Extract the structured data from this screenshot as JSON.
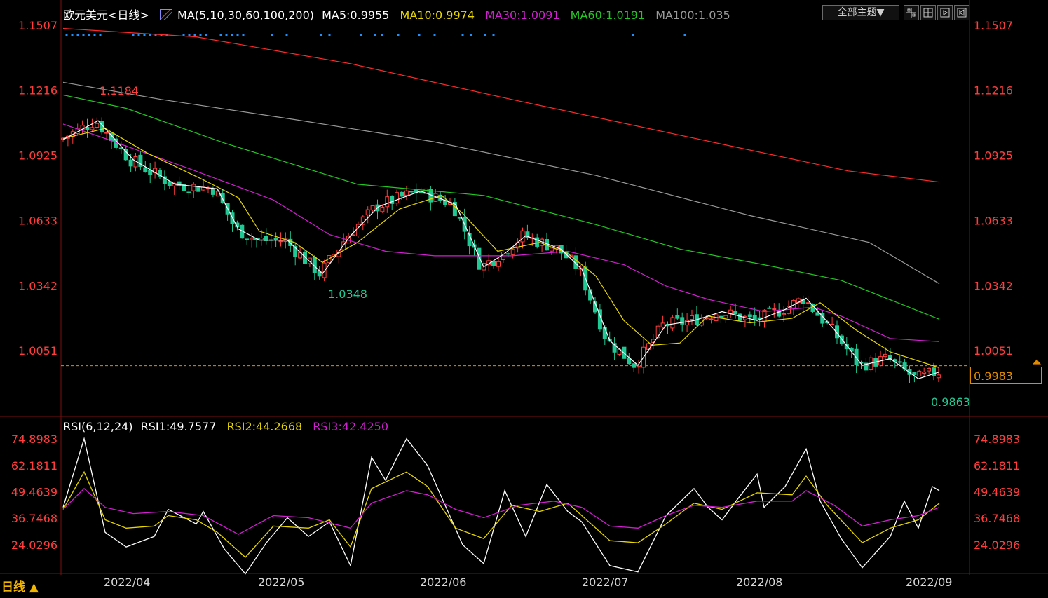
{
  "header": {
    "title": "欧元美元<日线>",
    "ma_label": "MA(5,10,30,60,100,200)",
    "ma_values": [
      {
        "text": "MA5:0.9955",
        "color": "#ffffff"
      },
      {
        "text": "MA10:0.9974",
        "color": "#e8d800"
      },
      {
        "text": "MA30:1.0091",
        "color": "#d21fd2"
      },
      {
        "text": "MA60:1.0191",
        "color": "#22c922"
      },
      {
        "text": "MA100:1.035",
        "color": "#9a9a9a"
      }
    ],
    "theme_button": "全部主题▼",
    "toolbar_icons": [
      "grid-icon",
      "split-icon",
      "export-icon",
      "fullscreen-icon"
    ]
  },
  "rsi_header": {
    "label": "RSI(6,12,24)",
    "values": [
      {
        "text": "RSI1:49.7577",
        "color": "#ffffff"
      },
      {
        "text": "RSI2:44.2668",
        "color": "#e8d800"
      },
      {
        "text": "RSI3:42.4250",
        "color": "#d21fd2"
      }
    ]
  },
  "period_label": "日线 ▲",
  "current_price": "0.9983",
  "colors": {
    "up": "#ff3d3d",
    "down": "#20c994",
    "axis_text": "#ff3d3d",
    "ma200": "#ff2a2a",
    "dashed": "#e08a00",
    "signal_dots": "#1e90ff"
  },
  "chart_data": {
    "type": "candlestick",
    "title": "欧元美元<日线>",
    "price_axis": {
      "ticks": [
        "1.1507",
        "1.1216",
        "1.0925",
        "1.0633",
        "1.0342",
        "1.0051"
      ],
      "range": [
        0.978,
        1.1507
      ]
    },
    "rsi_axis": {
      "ticks": [
        "74.8983",
        "62.1811",
        "49.4639",
        "36.7468",
        "24.0296"
      ]
    },
    "x_axis": {
      "labels": [
        "2022/04",
        "2022/05",
        "2022/06",
        "2022/07",
        "2022/08",
        "2022/09"
      ]
    },
    "annotations": {
      "high": "1.1184",
      "low_may": "1.0348",
      "low_sep": "0.9863"
    },
    "ma_series": [
      {
        "name": "MA200",
        "color": "#ff2a2a",
        "points": [
          [
            0,
            1.1493
          ],
          [
            190,
            1.1455
          ],
          [
            410,
            1.1335
          ],
          [
            640,
            1.1175
          ],
          [
            880,
            1.1015
          ],
          [
            1120,
            1.0855
          ],
          [
            1250,
            1.0805
          ]
        ]
      },
      {
        "name": "MA100",
        "color": "#9a9a9a",
        "points": [
          [
            0,
            1.1252
          ],
          [
            140,
            1.1175
          ],
          [
            330,
            1.1085
          ],
          [
            530,
            1.0985
          ],
          [
            760,
            1.0835
          ],
          [
            980,
            1.0655
          ],
          [
            1150,
            1.0535
          ],
          [
            1250,
            1.035
          ]
        ]
      },
      {
        "name": "MA60",
        "color": "#22c922",
        "points": [
          [
            0,
            1.1195
          ],
          [
            90,
            1.1135
          ],
          [
            230,
            1.098
          ],
          [
            420,
            1.0795
          ],
          [
            600,
            1.0745
          ],
          [
            760,
            1.0615
          ],
          [
            880,
            1.0505
          ],
          [
            1000,
            1.0435
          ],
          [
            1110,
            1.0365
          ],
          [
            1250,
            1.0191
          ]
        ]
      },
      {
        "name": "MA30",
        "color": "#d21fd2",
        "points": [
          [
            0,
            1.1065
          ],
          [
            60,
            1.1
          ],
          [
            180,
            1.0865
          ],
          [
            300,
            1.0725
          ],
          [
            380,
            1.057
          ],
          [
            460,
            1.0495
          ],
          [
            530,
            1.0475
          ],
          [
            640,
            1.0475
          ],
          [
            720,
            1.0495
          ],
          [
            800,
            1.0435
          ],
          [
            860,
            1.034
          ],
          [
            920,
            1.028
          ],
          [
            1000,
            1.0225
          ],
          [
            1070,
            1.0245
          ],
          [
            1110,
            1.0205
          ],
          [
            1180,
            1.0105
          ],
          [
            1250,
            1.0091
          ]
        ]
      },
      {
        "name": "MA10",
        "color": "#e8d800",
        "points": [
          [
            0,
            1.1
          ],
          [
            60,
            1.1045
          ],
          [
            120,
            1.0935
          ],
          [
            200,
            1.0815
          ],
          [
            250,
            1.0735
          ],
          [
            280,
            1.0585
          ],
          [
            330,
            1.0535
          ],
          [
            370,
            1.0445
          ],
          [
            420,
            1.0535
          ],
          [
            480,
            1.0685
          ],
          [
            540,
            1.0745
          ],
          [
            570,
            1.0665
          ],
          [
            620,
            1.0495
          ],
          [
            680,
            1.0535
          ],
          [
            720,
            1.0485
          ],
          [
            760,
            1.0385
          ],
          [
            800,
            1.0185
          ],
          [
            840,
            1.0075
          ],
          [
            880,
            1.0085
          ],
          [
            920,
            1.0205
          ],
          [
            980,
            1.0175
          ],
          [
            1040,
            1.0195
          ],
          [
            1080,
            1.0265
          ],
          [
            1130,
            1.0145
          ],
          [
            1180,
            1.0045
          ],
          [
            1250,
            0.9974
          ]
        ]
      },
      {
        "name": "MA5",
        "color": "#ffffff",
        "points": [
          [
            0,
            1.0995
          ],
          [
            50,
            1.108
          ],
          [
            100,
            1.0905
          ],
          [
            160,
            1.0795
          ],
          [
            220,
            1.0775
          ],
          [
            250,
            1.0595
          ],
          [
            280,
            1.0545
          ],
          [
            320,
            1.0545
          ],
          [
            370,
            1.0395
          ],
          [
            410,
            1.0565
          ],
          [
            450,
            1.0695
          ],
          [
            510,
            1.0765
          ],
          [
            560,
            1.0705
          ],
          [
            600,
            1.0425
          ],
          [
            630,
            1.0485
          ],
          [
            660,
            1.0565
          ],
          [
            710,
            1.0505
          ],
          [
            740,
            1.0415
          ],
          [
            780,
            1.0095
          ],
          [
            820,
            0.9985
          ],
          [
            860,
            1.0165
          ],
          [
            900,
            1.0185
          ],
          [
            940,
            1.0225
          ],
          [
            990,
            1.0185
          ],
          [
            1030,
            1.0235
          ],
          [
            1060,
            1.0285
          ],
          [
            1100,
            1.0145
          ],
          [
            1140,
            0.9985
          ],
          [
            1180,
            1.0015
          ],
          [
            1220,
            0.9925
          ],
          [
            1250,
            0.9955
          ]
        ]
      },
      {
        "name": "RSI1",
        "color": "#ffffff",
        "points": [
          [
            0,
            42
          ],
          [
            30,
            75
          ],
          [
            60,
            30
          ],
          [
            90,
            23
          ],
          [
            130,
            28
          ],
          [
            150,
            41
          ],
          [
            190,
            34
          ],
          [
            200,
            40
          ],
          [
            230,
            22
          ],
          [
            260,
            10
          ],
          [
            290,
            25
          ],
          [
            320,
            37
          ],
          [
            350,
            28
          ],
          [
            380,
            35
          ],
          [
            410,
            14
          ],
          [
            440,
            66
          ],
          [
            460,
            55
          ],
          [
            490,
            75
          ],
          [
            520,
            62
          ],
          [
            570,
            24
          ],
          [
            600,
            15
          ],
          [
            630,
            50
          ],
          [
            660,
            28
          ],
          [
            690,
            53
          ],
          [
            720,
            40
          ],
          [
            740,
            35
          ],
          [
            780,
            14
          ],
          [
            820,
            11
          ],
          [
            860,
            38
          ],
          [
            900,
            51
          ],
          [
            920,
            42
          ],
          [
            940,
            36
          ],
          [
            960,
            45
          ],
          [
            990,
            58
          ],
          [
            1000,
            42
          ],
          [
            1030,
            52
          ],
          [
            1060,
            70
          ],
          [
            1080,
            45
          ],
          [
            1110,
            27
          ],
          [
            1140,
            13
          ],
          [
            1180,
            28
          ],
          [
            1200,
            45
          ],
          [
            1220,
            32
          ],
          [
            1240,
            52
          ],
          [
            1250,
            50
          ]
        ]
      },
      {
        "name": "RSI2",
        "color": "#e8d800",
        "points": [
          [
            0,
            41
          ],
          [
            30,
            59
          ],
          [
            60,
            36
          ],
          [
            90,
            32
          ],
          [
            130,
            33
          ],
          [
            150,
            38
          ],
          [
            190,
            36
          ],
          [
            220,
            30
          ],
          [
            260,
            18
          ],
          [
            300,
            33
          ],
          [
            350,
            32
          ],
          [
            380,
            36
          ],
          [
            410,
            23
          ],
          [
            440,
            51
          ],
          [
            490,
            59
          ],
          [
            520,
            52
          ],
          [
            560,
            32
          ],
          [
            600,
            27
          ],
          [
            640,
            43
          ],
          [
            680,
            40
          ],
          [
            720,
            44
          ],
          [
            780,
            26
          ],
          [
            820,
            25
          ],
          [
            860,
            34
          ],
          [
            900,
            44
          ],
          [
            940,
            41
          ],
          [
            990,
            49
          ],
          [
            1040,
            48
          ],
          [
            1060,
            57
          ],
          [
            1090,
            43
          ],
          [
            1140,
            25
          ],
          [
            1180,
            32
          ],
          [
            1220,
            36
          ],
          [
            1250,
            44
          ]
        ]
      },
      {
        "name": "RSI3",
        "color": "#d21fd2",
        "points": [
          [
            0,
            41
          ],
          [
            30,
            51
          ],
          [
            60,
            42
          ],
          [
            100,
            39
          ],
          [
            150,
            40
          ],
          [
            200,
            38
          ],
          [
            250,
            29
          ],
          [
            300,
            38
          ],
          [
            350,
            37
          ],
          [
            410,
            32
          ],
          [
            440,
            44
          ],
          [
            490,
            50
          ],
          [
            520,
            48
          ],
          [
            560,
            41
          ],
          [
            600,
            37
          ],
          [
            650,
            43
          ],
          [
            700,
            45
          ],
          [
            740,
            42
          ],
          [
            780,
            33
          ],
          [
            820,
            32
          ],
          [
            860,
            38
          ],
          [
            900,
            43
          ],
          [
            940,
            42
          ],
          [
            990,
            45
          ],
          [
            1040,
            45
          ],
          [
            1060,
            50
          ],
          [
            1100,
            43
          ],
          [
            1140,
            33
          ],
          [
            1180,
            36
          ],
          [
            1220,
            38
          ],
          [
            1250,
            42
          ]
        ]
      }
    ],
    "candles": []
  }
}
